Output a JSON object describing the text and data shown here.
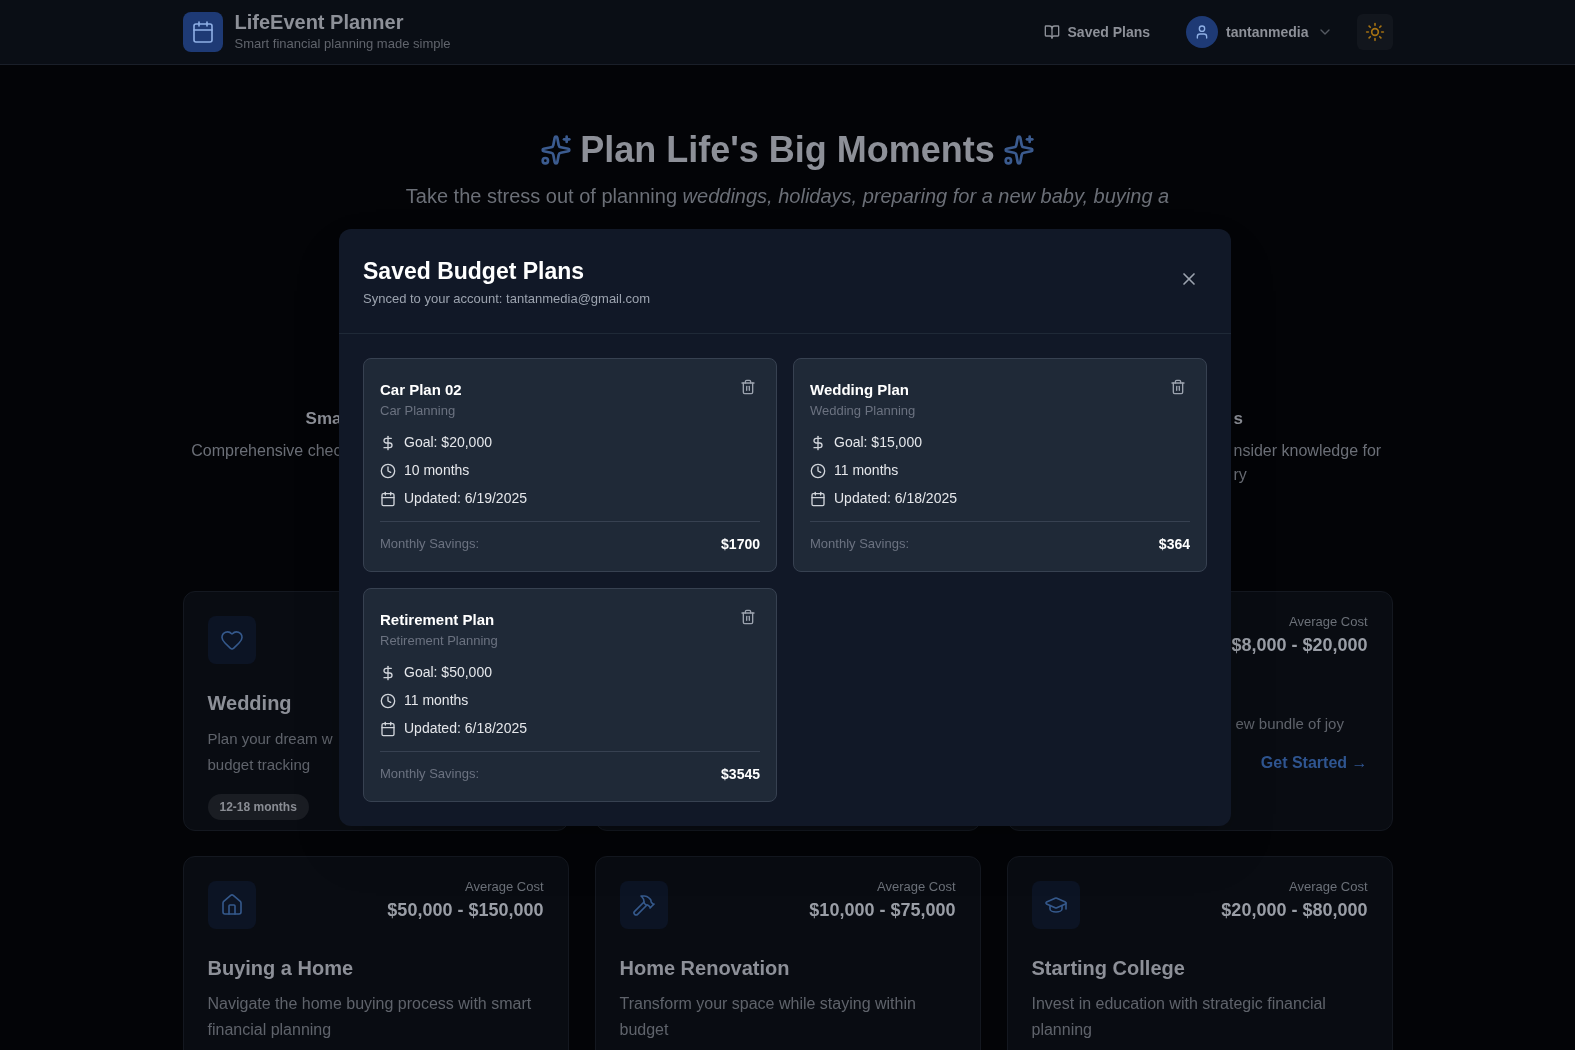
{
  "header": {
    "title": "LifeEvent Planner",
    "tagline": "Smart financial planning made simple",
    "saved_plans": "Saved Plans",
    "user": "tantanmedia"
  },
  "hero": {
    "title": "Plan Life's Big Moments",
    "subtitle": "Take the stress out of planning *weddings, holidays, preparing for a new baby, buying a*"
  },
  "features": [
    {
      "heading": "Sma",
      "lines": [
        "Comprehensive chec"
      ]
    },
    {
      "heading": "s",
      "lines": [
        "nsider knowledge for",
        "ry"
      ]
    }
  ],
  "event_rows": [
    [
      {
        "title": "Wedding",
        "description": [
          "Plan your dream w",
          "budget tracking"
        ],
        "badge": "12-18 months"
      },
      {},
      {
        "cost_label": "Average Cost",
        "cost": "$8,000 - $20,000",
        "description": [
          "ew bundle of joy"
        ],
        "link": "Get Started →"
      }
    ],
    [
      {
        "cost_label": "Average Cost",
        "cost": "$50,000 - $150,000",
        "title": "Buying a Home",
        "description": [
          "Navigate the home buying process with smart financial planning"
        ]
      },
      {
        "cost_label": "Average Cost",
        "cost": "$10,000 - $75,000",
        "title": "Home Renovation",
        "description": [
          "Transform your space while staying within budget"
        ]
      },
      {
        "cost_label": "Average Cost",
        "cost": "$20,000 - $80,000",
        "title": "Starting College",
        "description": [
          "Invest in education with strategic financial planning"
        ]
      }
    ]
  ],
  "modal": {
    "title": "Saved Budget Plans",
    "subtitle": "Synced to your account: tantanmedia@gmail.com",
    "plans": [
      {
        "name": "Car Plan 02",
        "category": "Car Planning",
        "goal": "Goal: $20,000",
        "duration": "10 months",
        "updated": "Updated: 6/19/2025",
        "savings_label": "Monthly Savings:",
        "savings": "$1700"
      },
      {
        "name": "Wedding Plan",
        "category": "Wedding Planning",
        "goal": "Goal: $15,000",
        "duration": "11 months",
        "updated": "Updated: 6/18/2025",
        "savings_label": "Monthly Savings:",
        "savings": "$364"
      },
      {
        "name": "Retirement Plan",
        "category": "Retirement Planning",
        "goal": "Goal: $50,000",
        "duration": "11 months",
        "updated": "Updated: 6/18/2025",
        "savings_label": "Monthly Savings:",
        "savings": "$3545"
      }
    ]
  }
}
